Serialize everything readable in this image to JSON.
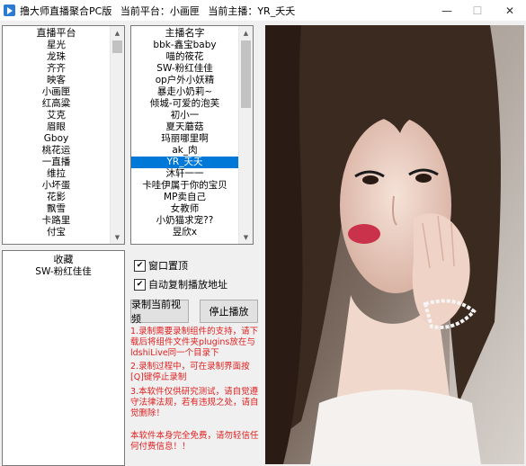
{
  "window": {
    "title_parts": [
      "撸大师直播聚合PC版",
      "当前平台：小画匣",
      "当前主播：YR_夭夭"
    ],
    "controls": {
      "minimize": "—",
      "maximize": "☐",
      "close": "✕"
    }
  },
  "platforms": {
    "header": "直播平台",
    "items": [
      "星光",
      "龙珠",
      "齐齐",
      "映客",
      "小画匣",
      "红高粱",
      "艾克",
      "眉眼",
      "Gboy",
      "桃花运",
      "一直播",
      "维拉",
      "小坏蛋",
      "花影",
      "飘雪",
      "卡路里",
      "付宝"
    ]
  },
  "anchors": {
    "header": "主播名字",
    "selected_index": 11,
    "items": [
      "bbk-鑫宝baby",
      "喵的筱花",
      "SW-粉红佳佳",
      "op户外小妖精",
      "暴走小奶莉~",
      "倾城-可爱的泡芙",
      "初小一",
      "夏天蘑菇",
      "玛丽哪里啊",
      "ak_肉",
      "YR_夭夭",
      "沐轩一一",
      "卡哇伊属于你的宝贝",
      "MP卖自己",
      "女教师",
      "小奶猫求宠??",
      "昱欣x"
    ]
  },
  "favorites": {
    "header": "收藏",
    "items": [
      "SW-粉红佳佳"
    ]
  },
  "options": {
    "window_top": {
      "label": "窗口置顶",
      "checked": true
    },
    "auto_copy": {
      "label": "自动复制播放地址",
      "checked": true
    }
  },
  "buttons": {
    "record": "录制当前视频",
    "stop": "停止播放"
  },
  "notes": [
    "1.录制需要录制组件的支持，请下载后将组件文件夹plugins放在与ldshiLive同一个目录下",
    "2.录制过程中，可在录制界面按[Q]键停止录制",
    "3.本软件仅供研究测试，请自觉遵守法律法规，若有违规之处，请自觉删除！",
    "本软件本身完全免费，请勿轻信任何付费信息！！"
  ]
}
